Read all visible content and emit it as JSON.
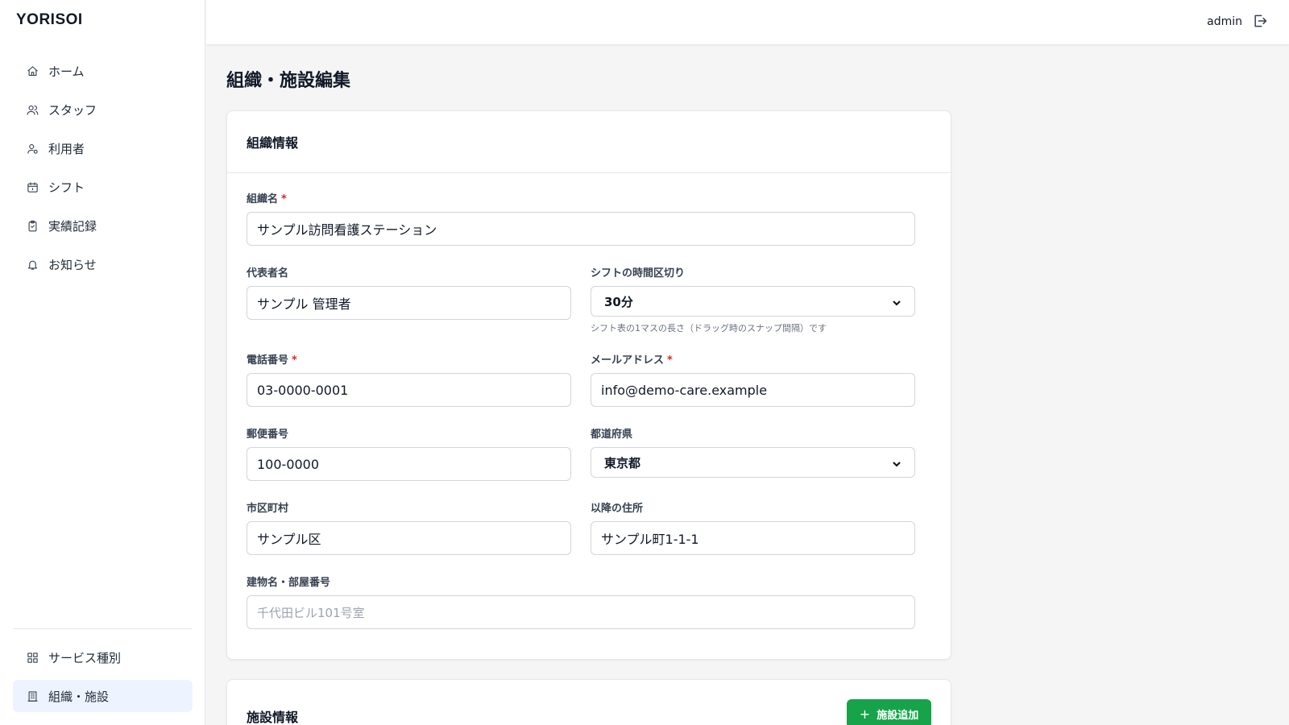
{
  "app": {
    "logo": "YORISOI",
    "user": "admin"
  },
  "nav": {
    "items": [
      {
        "label": "ホーム",
        "icon": "home-icon"
      },
      {
        "label": "スタッフ",
        "icon": "users-icon"
      },
      {
        "label": "利用者",
        "icon": "user-settings-icon"
      },
      {
        "label": "シフト",
        "icon": "calendar-icon"
      },
      {
        "label": "実績記録",
        "icon": "clipboard-icon"
      },
      {
        "label": "お知らせ",
        "icon": "bell-icon"
      }
    ],
    "bottom": [
      {
        "label": "サービス種別",
        "icon": "grid-icon"
      },
      {
        "label": "組織・施設",
        "icon": "building-icon",
        "active": true
      }
    ]
  },
  "page": {
    "title": "組織・施設編集"
  },
  "org_card": {
    "title": "組織情報",
    "fields": {
      "org_name": {
        "label": "組織名",
        "value": "サンプル訪問看護ステーション",
        "required": "*"
      },
      "rep_name": {
        "label": "代表者名",
        "value": "サンプル 管理者"
      },
      "shift_interval": {
        "label": "シフトの時間区切り",
        "value": "30分",
        "help": "シフト表の1マスの長さ（ドラッグ時のスナップ間隔）です"
      },
      "phone": {
        "label": "電話番号",
        "value": "03-0000-0001",
        "required": "*"
      },
      "email": {
        "label": "メールアドレス",
        "value": "info@demo-care.example",
        "required": "*"
      },
      "postal": {
        "label": "郵便番号",
        "value": "100-0000"
      },
      "prefecture": {
        "label": "都道府県",
        "value": "東京都"
      },
      "city": {
        "label": "市区町村",
        "value": "サンプル区"
      },
      "address": {
        "label": "以降の住所",
        "value": "サンプル町1-1-1"
      },
      "building": {
        "label": "建物名・部屋番号",
        "placeholder": "千代田ビル101号室"
      }
    }
  },
  "facility_card": {
    "title": "施設情報",
    "add_button": "施設追加",
    "add_icon": "+"
  },
  "colors": {
    "accent_green": "#16a34a",
    "required_red": "#dc2626",
    "active_nav_bg": "#eef4ff"
  }
}
